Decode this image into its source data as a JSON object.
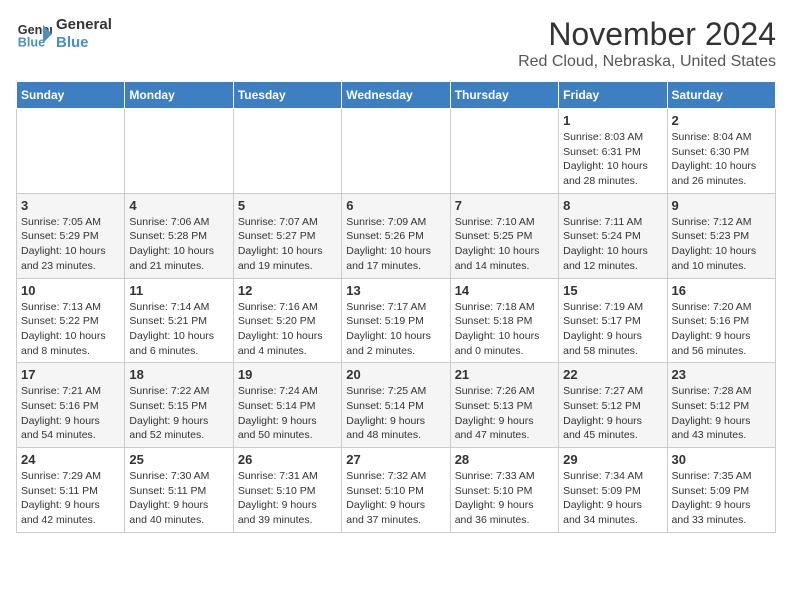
{
  "logo": {
    "line1": "General",
    "line2": "Blue"
  },
  "title": "November 2024",
  "subtitle": "Red Cloud, Nebraska, United States",
  "weekdays": [
    "Sunday",
    "Monday",
    "Tuesday",
    "Wednesday",
    "Thursday",
    "Friday",
    "Saturday"
  ],
  "weeks": [
    [
      {
        "day": "",
        "detail": ""
      },
      {
        "day": "",
        "detail": ""
      },
      {
        "day": "",
        "detail": ""
      },
      {
        "day": "",
        "detail": ""
      },
      {
        "day": "",
        "detail": ""
      },
      {
        "day": "1",
        "detail": "Sunrise: 8:03 AM\nSunset: 6:31 PM\nDaylight: 10 hours\nand 28 minutes."
      },
      {
        "day": "2",
        "detail": "Sunrise: 8:04 AM\nSunset: 6:30 PM\nDaylight: 10 hours\nand 26 minutes."
      }
    ],
    [
      {
        "day": "3",
        "detail": "Sunrise: 7:05 AM\nSunset: 5:29 PM\nDaylight: 10 hours\nand 23 minutes."
      },
      {
        "day": "4",
        "detail": "Sunrise: 7:06 AM\nSunset: 5:28 PM\nDaylight: 10 hours\nand 21 minutes."
      },
      {
        "day": "5",
        "detail": "Sunrise: 7:07 AM\nSunset: 5:27 PM\nDaylight: 10 hours\nand 19 minutes."
      },
      {
        "day": "6",
        "detail": "Sunrise: 7:09 AM\nSunset: 5:26 PM\nDaylight: 10 hours\nand 17 minutes."
      },
      {
        "day": "7",
        "detail": "Sunrise: 7:10 AM\nSunset: 5:25 PM\nDaylight: 10 hours\nand 14 minutes."
      },
      {
        "day": "8",
        "detail": "Sunrise: 7:11 AM\nSunset: 5:24 PM\nDaylight: 10 hours\nand 12 minutes."
      },
      {
        "day": "9",
        "detail": "Sunrise: 7:12 AM\nSunset: 5:23 PM\nDaylight: 10 hours\nand 10 minutes."
      }
    ],
    [
      {
        "day": "10",
        "detail": "Sunrise: 7:13 AM\nSunset: 5:22 PM\nDaylight: 10 hours\nand 8 minutes."
      },
      {
        "day": "11",
        "detail": "Sunrise: 7:14 AM\nSunset: 5:21 PM\nDaylight: 10 hours\nand 6 minutes."
      },
      {
        "day": "12",
        "detail": "Sunrise: 7:16 AM\nSunset: 5:20 PM\nDaylight: 10 hours\nand 4 minutes."
      },
      {
        "day": "13",
        "detail": "Sunrise: 7:17 AM\nSunset: 5:19 PM\nDaylight: 10 hours\nand 2 minutes."
      },
      {
        "day": "14",
        "detail": "Sunrise: 7:18 AM\nSunset: 5:18 PM\nDaylight: 10 hours\nand 0 minutes."
      },
      {
        "day": "15",
        "detail": "Sunrise: 7:19 AM\nSunset: 5:17 PM\nDaylight: 9 hours\nand 58 minutes."
      },
      {
        "day": "16",
        "detail": "Sunrise: 7:20 AM\nSunset: 5:16 PM\nDaylight: 9 hours\nand 56 minutes."
      }
    ],
    [
      {
        "day": "17",
        "detail": "Sunrise: 7:21 AM\nSunset: 5:16 PM\nDaylight: 9 hours\nand 54 minutes."
      },
      {
        "day": "18",
        "detail": "Sunrise: 7:22 AM\nSunset: 5:15 PM\nDaylight: 9 hours\nand 52 minutes."
      },
      {
        "day": "19",
        "detail": "Sunrise: 7:24 AM\nSunset: 5:14 PM\nDaylight: 9 hours\nand 50 minutes."
      },
      {
        "day": "20",
        "detail": "Sunrise: 7:25 AM\nSunset: 5:14 PM\nDaylight: 9 hours\nand 48 minutes."
      },
      {
        "day": "21",
        "detail": "Sunrise: 7:26 AM\nSunset: 5:13 PM\nDaylight: 9 hours\nand 47 minutes."
      },
      {
        "day": "22",
        "detail": "Sunrise: 7:27 AM\nSunset: 5:12 PM\nDaylight: 9 hours\nand 45 minutes."
      },
      {
        "day": "23",
        "detail": "Sunrise: 7:28 AM\nSunset: 5:12 PM\nDaylight: 9 hours\nand 43 minutes."
      }
    ],
    [
      {
        "day": "24",
        "detail": "Sunrise: 7:29 AM\nSunset: 5:11 PM\nDaylight: 9 hours\nand 42 minutes."
      },
      {
        "day": "25",
        "detail": "Sunrise: 7:30 AM\nSunset: 5:11 PM\nDaylight: 9 hours\nand 40 minutes."
      },
      {
        "day": "26",
        "detail": "Sunrise: 7:31 AM\nSunset: 5:10 PM\nDaylight: 9 hours\nand 39 minutes."
      },
      {
        "day": "27",
        "detail": "Sunrise: 7:32 AM\nSunset: 5:10 PM\nDaylight: 9 hours\nand 37 minutes."
      },
      {
        "day": "28",
        "detail": "Sunrise: 7:33 AM\nSunset: 5:10 PM\nDaylight: 9 hours\nand 36 minutes."
      },
      {
        "day": "29",
        "detail": "Sunrise: 7:34 AM\nSunset: 5:09 PM\nDaylight: 9 hours\nand 34 minutes."
      },
      {
        "day": "30",
        "detail": "Sunrise: 7:35 AM\nSunset: 5:09 PM\nDaylight: 9 hours\nand 33 minutes."
      }
    ]
  ]
}
